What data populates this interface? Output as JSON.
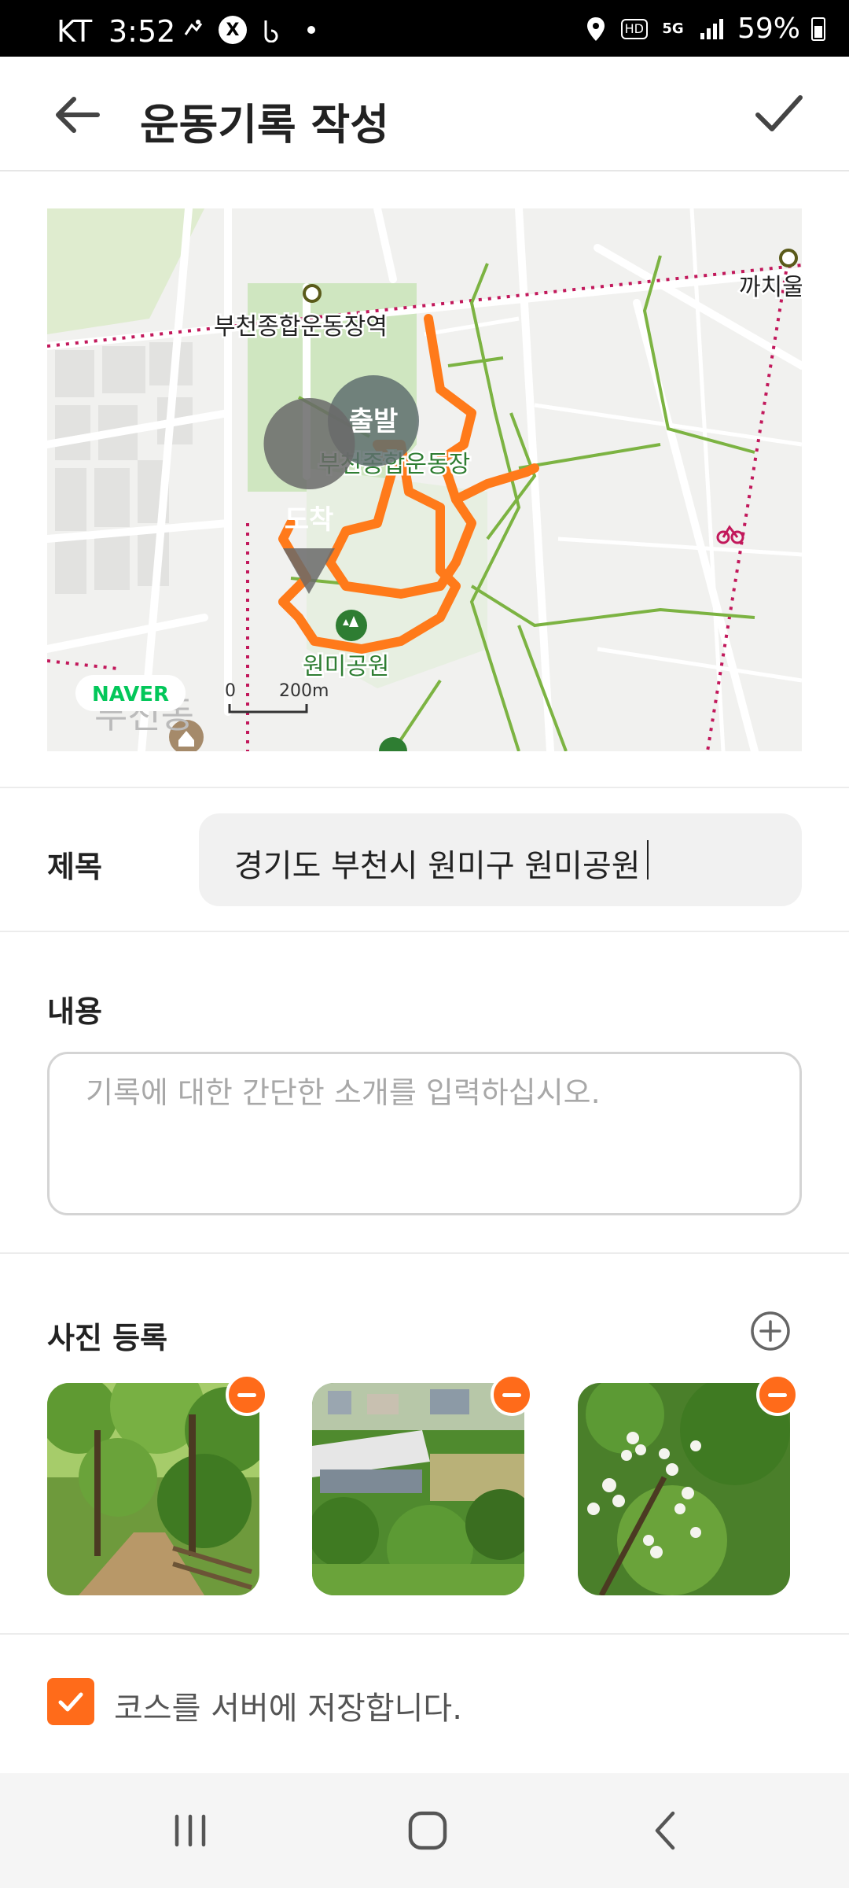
{
  "status_bar": {
    "carrier": "KT",
    "time": "3:52",
    "battery": "59%",
    "network": "5G",
    "hd": "HD",
    "icons": [
      "running-icon",
      "x-app-icon",
      "b-app-icon",
      "dot-icon",
      "location-icon",
      "hd-icon",
      "5g-icon",
      "signal-icon",
      "battery-icon"
    ]
  },
  "header": {
    "title": "운동기록 작성",
    "back_icon": "arrow-left-icon",
    "confirm_icon": "check-icon"
  },
  "map": {
    "labels": {
      "station_1": "부천종합운동장역",
      "station_2": "까치울",
      "stadium": "부천종합운동장",
      "park": "원미공원",
      "district": "부천동",
      "start_marker": "출발",
      "end_marker": "도착",
      "provider": "NAVER",
      "scale_start": "0",
      "scale_end": "200m"
    },
    "route_color": "#ff7a1a",
    "trail_color": "#7cb342",
    "rail_color": "#c2185b"
  },
  "form": {
    "title_label": "제목",
    "title_value": "경기도 부천시 원미구 원미공원",
    "content_label": "내용",
    "content_placeholder": "기록에 대한 간단한 소개를 입력하십시오.",
    "photo_label": "사진 등록",
    "photos": [
      {
        "name": "forest-path-photo",
        "remove_icon": "minus-circle-icon"
      },
      {
        "name": "stadium-view-photo",
        "remove_icon": "minus-circle-icon"
      },
      {
        "name": "white-flowers-photo",
        "remove_icon": "minus-circle-icon"
      }
    ],
    "save_course_checked": true,
    "save_course_label": "코스를 서버에 저장합니다."
  },
  "nav_bar": {
    "recent_icon": "recent-apps-icon",
    "home_icon": "home-icon",
    "back_icon": "back-chevron-icon"
  },
  "colors": {
    "accent": "#ff6b1a",
    "input_bg": "#f1f1f1",
    "divider": "#ececec"
  }
}
